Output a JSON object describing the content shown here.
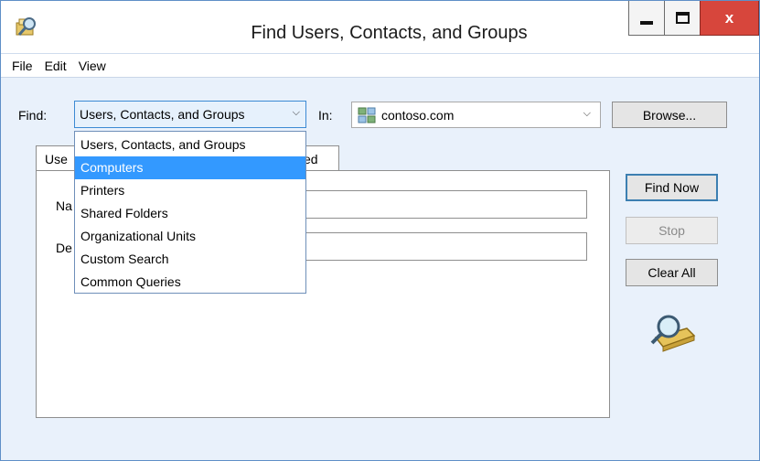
{
  "window": {
    "title": "Find Users, Contacts, and Groups",
    "close_glyph": "x",
    "icons": {
      "app": "find-app-icon",
      "minimize": "minimize-icon",
      "maximize": "maximize-icon",
      "close": "close-icon"
    }
  },
  "menu": {
    "items": [
      "File",
      "Edit",
      "View"
    ]
  },
  "find": {
    "label": "Find:",
    "value": "Users, Contacts, and Groups",
    "options": [
      "Users, Contacts, and Groups",
      "Computers",
      "Printers",
      "Shared Folders",
      "Organizational Units",
      "Custom Search",
      "Common Queries"
    ],
    "highlighted": "Computers",
    "chevron": "⌵"
  },
  "in": {
    "label": "In:",
    "value": "contoso.com",
    "icon": "domain-icon",
    "chevron": "⌵"
  },
  "browse_label": "Browse...",
  "tabs": [
    "Use",
    "ced"
  ],
  "fields": {
    "name_label": "Na",
    "desc_label": "De"
  },
  "buttons": {
    "find_now": "Find Now",
    "stop": "Stop",
    "clear_all": "Clear All"
  },
  "colors": {
    "accent": "#3399ff",
    "window_bg": "#e9f1fb",
    "close_red": "#d7463c"
  }
}
